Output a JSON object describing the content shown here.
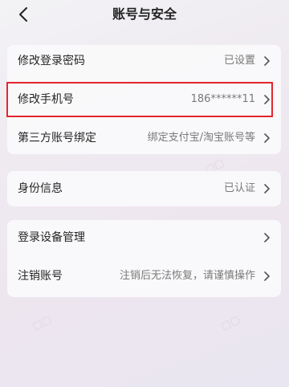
{
  "header": {
    "title": "账号与安全"
  },
  "rows": [
    {
      "label": "修改登录密码",
      "value": "已设置"
    },
    {
      "label": "修改手机号",
      "value": "186******11"
    },
    {
      "label": "第三方账号绑定",
      "value": "绑定支付宝/淘宝账号等"
    },
    {
      "label": "身份信息",
      "value": "已认证"
    },
    {
      "label": "登录设备管理",
      "value": ""
    },
    {
      "label": "注销账号",
      "value": "注销后无法恢复，请谨慎操作"
    }
  ],
  "colors": {
    "highlight_border": "#e3262e",
    "value_text": "#7a7a7a"
  },
  "icons": {
    "back": "chevron-left-icon",
    "row_arrow": "chevron-right-icon"
  }
}
